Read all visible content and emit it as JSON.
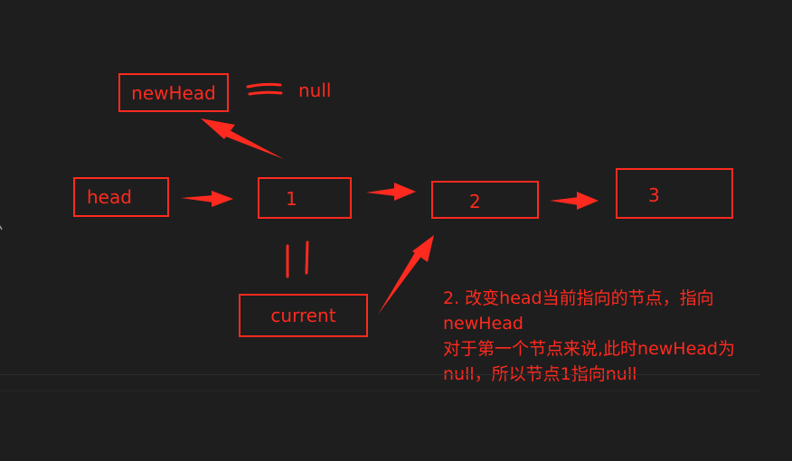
{
  "nodes": {
    "newhead": "newHead",
    "head": "head",
    "n1": "1",
    "n2": "2",
    "n3": "3",
    "current": "current"
  },
  "null_label": "null",
  "note": {
    "line1": "2. 改变head当前指向的节点，指向",
    "line2": "newHead",
    "line3": "对于第一个节点来说,此时newHead为",
    "line4": "null，所以节点1指向null"
  },
  "colors": {
    "ink": "#ff2a1f",
    "background": "#1e1e1e"
  }
}
